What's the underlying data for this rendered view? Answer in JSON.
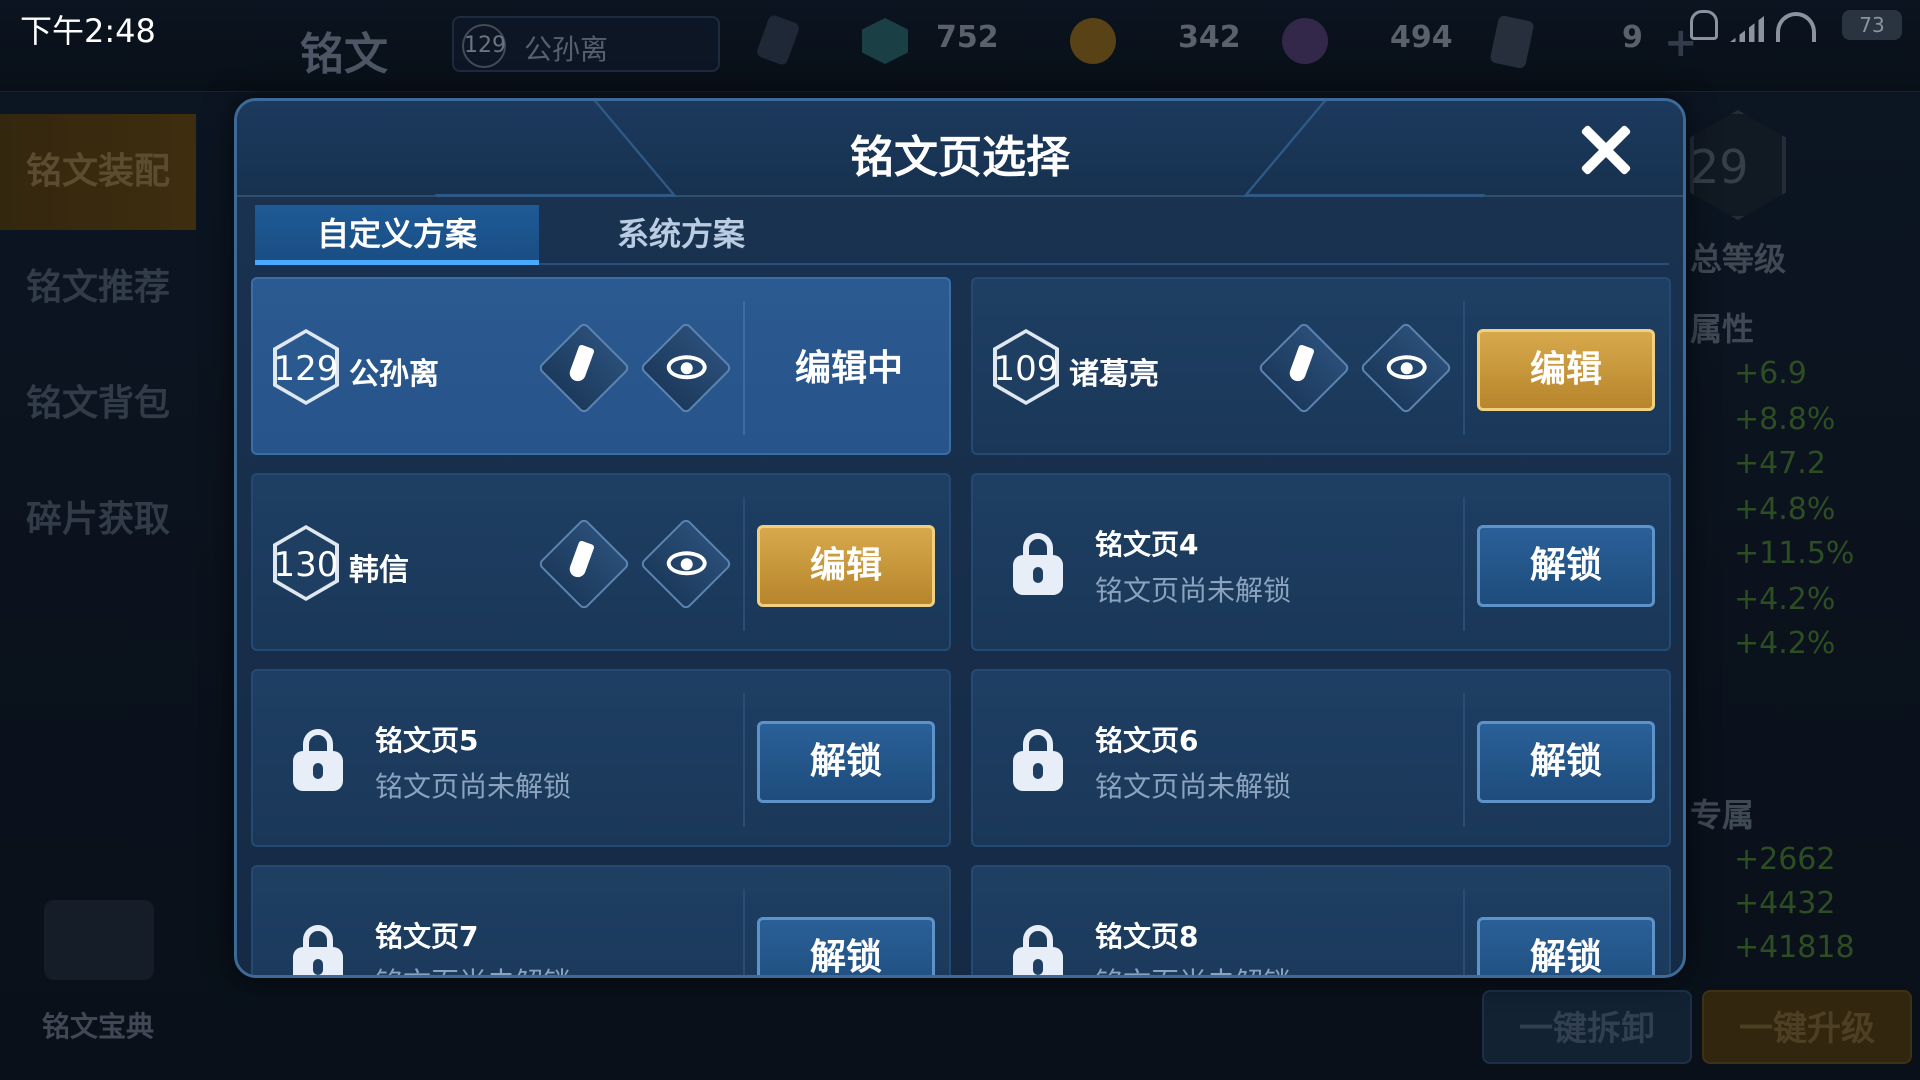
{
  "status_bar": {
    "time": "下午2:48",
    "battery": "73"
  },
  "background": {
    "page_title": "铭文",
    "hero": {
      "level": "129",
      "name": "公孙离"
    },
    "resources": [
      "752",
      "342",
      "494",
      "9"
    ],
    "sidebar": [
      "铭文装配",
      "铭文推荐",
      "铭文背包",
      "碎片获取"
    ],
    "sidebar_bottom": "铭文宝典",
    "right_panel": {
      "total_level_num": "29",
      "total_level_label": "总等级",
      "attr_label": "属性",
      "attr_values": [
        "+6.9",
        "+8.8%",
        "+47.2",
        "+4.8%",
        "+11.5%",
        "+4.2%",
        "+4.2%"
      ],
      "exclusive_label": "专属",
      "exclusive_values": [
        "+2662",
        "+4432",
        "+41818"
      ]
    },
    "buttons": {
      "remove_all": "一键拆卸",
      "upgrade_all": "一键升级"
    }
  },
  "dialog": {
    "title": "铭文页选择",
    "tabs": {
      "custom": "自定义方案",
      "system": "系统方案"
    },
    "slots": [
      {
        "level": "129",
        "name": "公孙离",
        "status": "编辑中"
      },
      {
        "level": "109",
        "name": "诸葛亮",
        "action": "编辑"
      },
      {
        "level": "130",
        "name": "韩信",
        "action": "编辑"
      },
      {
        "title": "铭文页4",
        "subtitle": "铭文页尚未解锁",
        "action": "解锁"
      },
      {
        "title": "铭文页5",
        "subtitle": "铭文页尚未解锁",
        "action": "解锁"
      },
      {
        "title": "铭文页6",
        "subtitle": "铭文页尚未解锁",
        "action": "解锁"
      },
      {
        "title": "铭文页7",
        "subtitle": "铭文页尚未解锁",
        "action": "解锁"
      },
      {
        "title": "铭文页8",
        "subtitle": "铭文页尚未解锁",
        "action": "解锁"
      }
    ]
  },
  "colors": {
    "dialog_bg": "#1a3352",
    "selected_slot": "#2b5a90",
    "gold_button": "#d7a94c",
    "blue_button": "#2a6098"
  }
}
